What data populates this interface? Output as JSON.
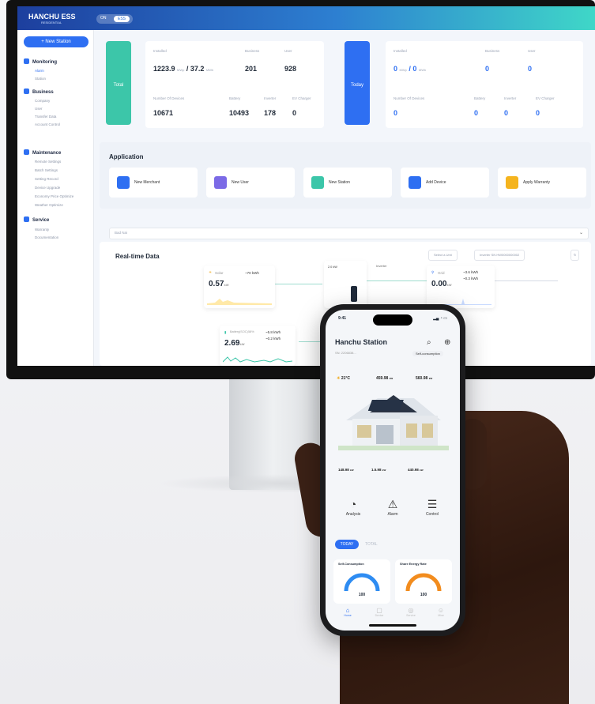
{
  "dashboard": {
    "brand": "HANCHU ESS",
    "brand_sub": "RESIDENTIAL",
    "toggle": {
      "option1": "ON",
      "option2": "ESS"
    },
    "sidebar": {
      "new_station": "+ New Station",
      "sections": [
        {
          "label": "Monitoring",
          "items": [
            "Alarm",
            "Station"
          ]
        },
        {
          "label": "Business",
          "items": [
            "Company",
            "User",
            "Transfer Data",
            "Account Control"
          ]
        },
        {
          "label": "Maintenance",
          "items": [
            "Remote Settings",
            "Batch Settings",
            "Setting Record",
            "Device Upgrade",
            "Economy Price Optimize",
            "Weather Optimize"
          ]
        },
        {
          "label": "Service",
          "items": [
            "Warranty",
            "Documentation"
          ]
        }
      ]
    },
    "total": {
      "label": "Total",
      "installed_label": "Installed",
      "installed_value": "1223.9",
      "installed_unit1": "MWp",
      "installed_value2": "37.2",
      "installed_unit2": "MWh",
      "business_label": "Business",
      "business_value": "201",
      "user_label": "User",
      "user_value": "928",
      "devices_label": "Number Of Devices",
      "devices_value": "10671",
      "battery_label": "Battery",
      "battery_value": "10493",
      "inverter_label": "Inverter",
      "inverter_value": "178",
      "ev_label": "EV Charger",
      "ev_value": "0"
    },
    "today": {
      "label": "Today",
      "installed_label": "Installed",
      "installed_value": "0",
      "installed_unit1": "MWp",
      "installed_value2": "0",
      "installed_unit2": "MWh",
      "business_label": "Business",
      "business_value": "0",
      "user_label": "User",
      "user_value": "0",
      "devices_label": "Number Of Devices",
      "devices_value": "0",
      "battery_label": "Battery",
      "battery_value": "0",
      "inverter_label": "Inverter",
      "inverter_value": "0",
      "ev_label": "EV Charger",
      "ev_value": "0"
    },
    "application": {
      "title": "Application",
      "buttons": [
        {
          "label": "New Merchant",
          "color": "#2e6ff2"
        },
        {
          "label": "New User",
          "color": "#7b6ae6"
        },
        {
          "label": "New Station",
          "color": "#3cc6a9"
        },
        {
          "label": "Add Device",
          "color": "#2e6ff2"
        },
        {
          "label": "Apply Warranty",
          "color": "#f5b41e"
        }
      ]
    },
    "station_select": "Bad Nai",
    "realtime": {
      "title": "Real-time Data",
      "chip1": "Select a Unit",
      "chip2": "Inverter SN  HW0000000002",
      "solar_label": "Solar",
      "solar_value": "0.57",
      "solar_unit": "kW",
      "solar_total": "~70 kWh",
      "grid_label": "Grid",
      "grid_value": "0.00",
      "grid_unit": "kW",
      "grid_a": "~3.6 kWh",
      "grid_b": "~0.3 kWh",
      "battery_label": "Battery(SOC)",
      "battery_soc": "58%",
      "battery_value": "2.69",
      "battery_unit": "kW",
      "battery_a": "~5.8 kWh",
      "battery_b": "~0.2 kWh",
      "inverter_value": "2.0 kW",
      "inverter_label": "Inverter"
    }
  },
  "phone": {
    "time": "9:41",
    "title": "Hanchu Station",
    "subtitle": "SN: 2206838...",
    "self_consumption_btn": "Self-consumption",
    "weather": "21°C",
    "top_vals": [
      {
        "value": "459.98",
        "unit": "kW"
      },
      {
        "value": "560.98",
        "unit": "kW"
      }
    ],
    "bottom_vals": [
      {
        "value": "148.98",
        "unit": "kW"
      },
      {
        "value": "1.5.98",
        "unit": "kW"
      },
      {
        "value": "440.98",
        "unit": "kW"
      }
    ],
    "quick": [
      {
        "label": "Analysis",
        "icon": "pie-chart-icon"
      },
      {
        "label": "Alarm",
        "icon": "alarm-icon"
      },
      {
        "label": "Control",
        "icon": "control-icon"
      }
    ],
    "tab_today": "TODAY",
    "tab_total": "TOTAL",
    "gauges": [
      {
        "title": "Self-Consumption",
        "value": "100",
        "color": "#2e8cf2",
        "percent": 100
      },
      {
        "title": "Share Energy Rate",
        "value": "100",
        "color": "#f28c1e",
        "percent": 100
      }
    ],
    "bottom_nav": [
      "Home",
      "Device",
      "Service",
      "Mine"
    ]
  }
}
